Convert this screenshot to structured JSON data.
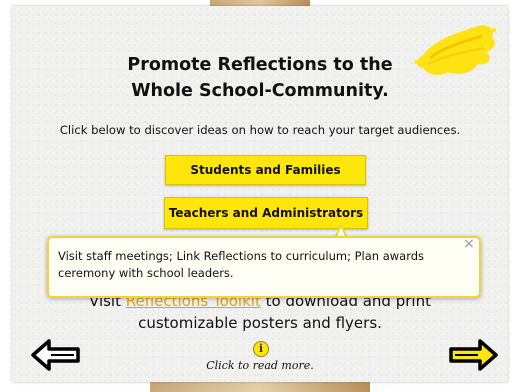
{
  "title": {
    "line1": "Promote Reflections to the",
    "line2": "Whole School-Community."
  },
  "subtitle": "Click below to discover ideas on how to reach your target audiences.",
  "buttons": {
    "students": "Students and Families",
    "teachers": "Teachers and Administrators"
  },
  "tooltip": {
    "text": "Visit staff meetings; Link Reflections to curriculum; Plan awards ceremony with school leaders.",
    "close": "×"
  },
  "visit": {
    "prefix": "Visit ",
    "link": "Reflections Toolkit",
    "suffix": " to download and print",
    "line2": "customizable posters and flyers."
  },
  "footer": {
    "info_glyph": "i",
    "read_more": "Click to read more."
  },
  "colors": {
    "accent": "#ffe60a",
    "link": "#e9a300",
    "board": "#f1f1ef"
  },
  "icons": {
    "prev": "arrow-left-icon",
    "next": "arrow-right-icon",
    "info": "info-icon",
    "close": "close-icon",
    "decor": "yellow-paint-splash"
  }
}
